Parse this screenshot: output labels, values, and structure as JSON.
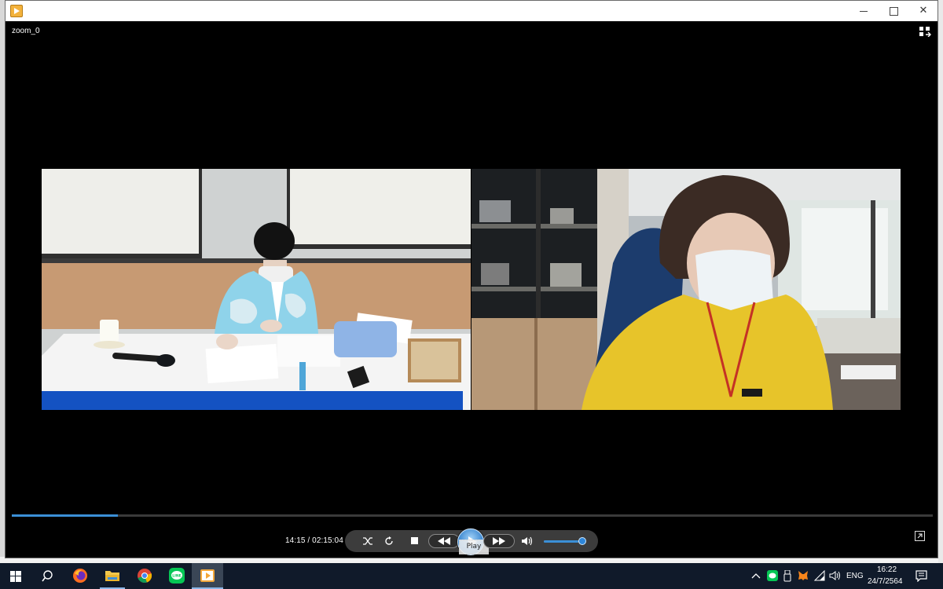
{
  "window": {
    "media_title": "zoom_0",
    "controls": {
      "minimize": "minimize",
      "maximize": "maximize",
      "close": "✕"
    }
  },
  "player": {
    "current_time": "14:15",
    "duration": "02:15:04",
    "time_readout": "14:15 / 02:15:04",
    "progress_fraction": 0.115,
    "volume_fraction": 0.85,
    "play_tooltip": "Play",
    "accent_color": "#3b8fd6"
  },
  "taskbar": {
    "items": [
      {
        "name": "windows-start-icon"
      },
      {
        "name": "search-icon"
      },
      {
        "name": "firefox-icon"
      },
      {
        "name": "file-explorer-icon"
      },
      {
        "name": "chrome-icon"
      },
      {
        "name": "line-app-icon"
      },
      {
        "name": "media-player-icon"
      }
    ],
    "language": "ENG",
    "clock_time": "16:22",
    "clock_date": "24/7/2564"
  }
}
